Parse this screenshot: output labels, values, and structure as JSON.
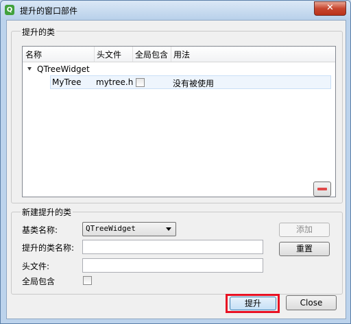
{
  "window": {
    "title": "提升的窗口部件",
    "close_label": "✕",
    "icon_letter": "Q"
  },
  "promoted": {
    "group_title": "提升的类",
    "columns": [
      "名称",
      "头文件",
      "全局包含",
      "用法"
    ],
    "parent": {
      "name": "QTreeWidget"
    },
    "child": {
      "name": "MyTree",
      "header": "mytree.h",
      "global": false,
      "usage": "没有被使用"
    },
    "remove_label": "—"
  },
  "new_promoted": {
    "group_title": "新建提升的类",
    "base_class_label": "基类名称:",
    "base_class_value": "QTreeWidget",
    "promoted_class_label": "提升的类名称:",
    "promoted_class_value": "",
    "header_file_label": "头文件:",
    "header_file_value": "",
    "global_include_label": "全局包含",
    "add_label": "添加",
    "reset_label": "重置"
  },
  "footer": {
    "promote_label": "提升",
    "close_label": "Close"
  },
  "colors": {
    "highlight": "#e81123",
    "accent": "#3399ff"
  }
}
